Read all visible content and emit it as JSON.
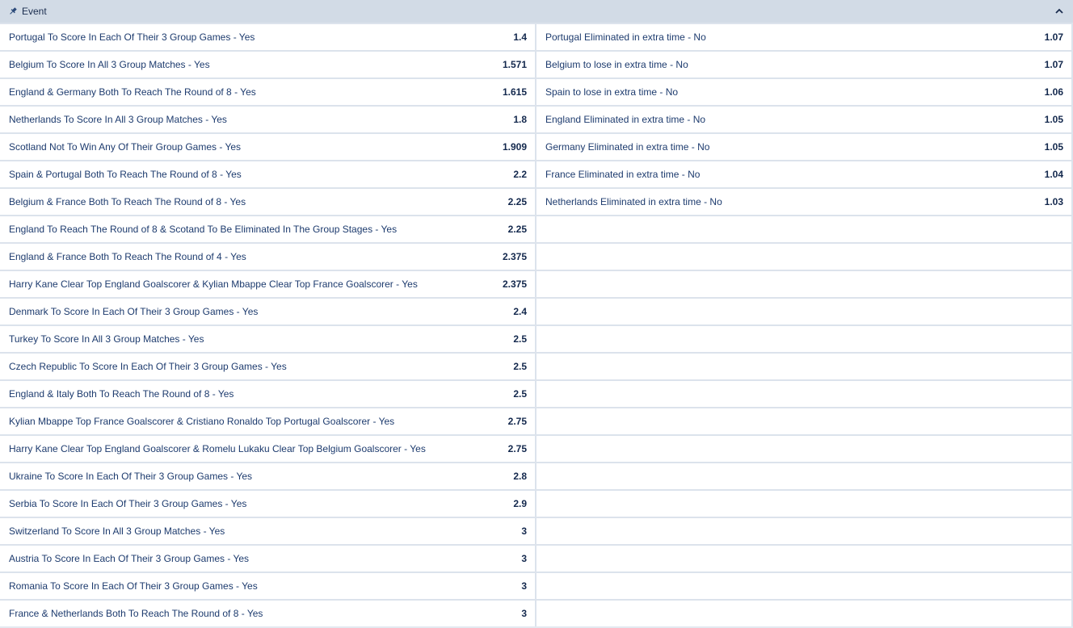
{
  "header": {
    "title": "Event",
    "pin_icon": "pin-icon",
    "collapse_icon": "chevron-up-icon"
  },
  "left": [
    {
      "label": "Portugal To Score In Each Of Their 3 Group Games - Yes",
      "odds": "1.4"
    },
    {
      "label": "Belgium To Score In All 3 Group Matches - Yes",
      "odds": "1.571"
    },
    {
      "label": "England & Germany Both To Reach The Round of 8 - Yes",
      "odds": "1.615"
    },
    {
      "label": "Netherlands To Score In All 3 Group Matches - Yes",
      "odds": "1.8"
    },
    {
      "label": "Scotland Not To Win Any Of Their Group Games - Yes",
      "odds": "1.909"
    },
    {
      "label": "Spain & Portugal Both To Reach The Round of 8 - Yes",
      "odds": "2.2"
    },
    {
      "label": "Belgium & France Both To Reach The Round of 8 - Yes",
      "odds": "2.25"
    },
    {
      "label": "England To Reach The Round of 8 & Scotand To Be Eliminated In The Group Stages - Yes",
      "odds": "2.25"
    },
    {
      "label": "England & France Both To Reach The Round of 4 - Yes",
      "odds": "2.375"
    },
    {
      "label": "Harry Kane Clear Top England Goalscorer & Kylian Mbappe Clear Top France Goalscorer - Yes",
      "odds": "2.375"
    },
    {
      "label": "Denmark To Score In Each Of Their 3 Group Games - Yes",
      "odds": "2.4"
    },
    {
      "label": "Turkey To Score In All 3 Group Matches - Yes",
      "odds": "2.5"
    },
    {
      "label": "Czech Republic To Score In Each Of Their 3 Group Games - Yes",
      "odds": "2.5"
    },
    {
      "label": "England & Italy Both To Reach The Round of 8 - Yes",
      "odds": "2.5"
    },
    {
      "label": "Kylian Mbappe Top France Goalscorer & Cristiano Ronaldo Top Portugal Goalscorer - Yes",
      "odds": "2.75"
    },
    {
      "label": "Harry Kane Clear Top England Goalscorer & Romelu Lukaku Clear Top Belgium Goalscorer - Yes",
      "odds": "2.75"
    },
    {
      "label": "Ukraine To Score In Each Of Their 3 Group Games - Yes",
      "odds": "2.8"
    },
    {
      "label": "Serbia To Score In Each Of Their 3 Group Games - Yes",
      "odds": "2.9"
    },
    {
      "label": "Switzerland To Score In All 3 Group Matches - Yes",
      "odds": "3"
    },
    {
      "label": "Austria To Score In Each Of Their 3 Group Games - Yes",
      "odds": "3"
    },
    {
      "label": "Romania To Score In Each Of Their 3 Group Games - Yes",
      "odds": "3"
    },
    {
      "label": "France & Netherlands Both To Reach The Round of 8 - Yes",
      "odds": "3"
    }
  ],
  "right": [
    {
      "label": "Portugal Eliminated in extra time - No",
      "odds": "1.07"
    },
    {
      "label": "Belgium to lose in extra time - No",
      "odds": "1.07"
    },
    {
      "label": "Spain to lose in extra time - No",
      "odds": "1.06"
    },
    {
      "label": "England Eliminated in extra time - No",
      "odds": "1.05"
    },
    {
      "label": "Germany Eliminated in extra time - No",
      "odds": "1.05"
    },
    {
      "label": "France Eliminated in extra time - No",
      "odds": "1.04"
    },
    {
      "label": "Netherlands Eliminated in extra time - No",
      "odds": "1.03"
    }
  ]
}
